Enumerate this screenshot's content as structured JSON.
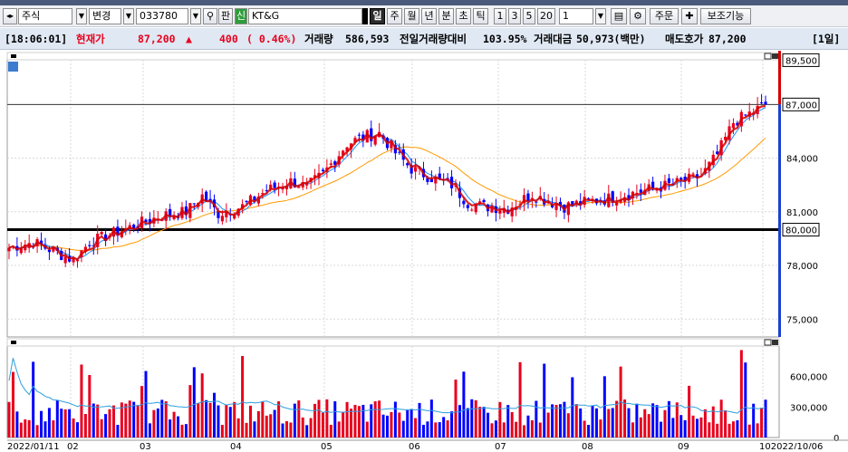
{
  "toolbar": {
    "market": "주식",
    "change_label": "변경",
    "code": "033780",
    "search_icon": "magnifier-icon",
    "pan_label": "판",
    "new_badge": "신",
    "stock_name": "KT&G",
    "periods": [
      "일",
      "주",
      "월",
      "년",
      "분",
      "초",
      "틱"
    ],
    "active_period": "일",
    "minute_options": [
      "1",
      "3",
      "5",
      "20"
    ],
    "count_value": "1",
    "order_label": "주문",
    "aux_label": "보조기능"
  },
  "info": {
    "time": "[18:06:01]",
    "price_label": "현재가",
    "price": "87,200",
    "change_sign": "▲",
    "change": "400",
    "change_pct": "( 0.46%)",
    "volume_label": "거래량",
    "volume": "586,593",
    "prev_vol_label": "전일거래량대비",
    "prev_vol_ratio": "103.95%",
    "amount_label": "거래대금",
    "amount": "50,973(백만)",
    "ask_label": "매도호가",
    "ask": "87,200",
    "period_badge": "[1일]"
  },
  "chart_data": {
    "type": "candlestick",
    "start_date": "2022/01/11",
    "end_date": "2022/10/06",
    "month_ticks": [
      "02",
      "03",
      "04",
      "05",
      "06",
      "07",
      "08",
      "09",
      "10"
    ],
    "price_axis_ticks": [
      "84,000",
      "81,000",
      "78,000",
      "75,000"
    ],
    "price_range": [
      74000,
      89500
    ],
    "markers": {
      "high": "89,500",
      "current": "87,000",
      "support": "80,000"
    },
    "support_level": 80000,
    "current_level": 87000,
    "volume_axis_ticks": [
      "600,000",
      "300,000",
      "0"
    ],
    "volume_range": [
      0,
      900000
    ],
    "price_path": [
      [
        0,
        79000
      ],
      [
        6,
        79300
      ],
      [
        12,
        78700
      ],
      [
        16,
        78300
      ],
      [
        20,
        79300
      ],
      [
        26,
        79800
      ],
      [
        32,
        80300
      ],
      [
        38,
        80800
      ],
      [
        44,
        81000
      ],
      [
        48,
        81900
      ],
      [
        52,
        80900
      ],
      [
        58,
        81300
      ],
      [
        64,
        82200
      ],
      [
        70,
        82700
      ],
      [
        74,
        82400
      ],
      [
        78,
        83100
      ],
      [
        84,
        84800
      ],
      [
        88,
        85200
      ],
      [
        92,
        85400
      ],
      [
        96,
        84300
      ],
      [
        100,
        83400
      ],
      [
        106,
        82800
      ],
      [
        110,
        82500
      ],
      [
        114,
        81500
      ],
      [
        118,
        81300
      ],
      [
        124,
        81200
      ],
      [
        130,
        82000
      ],
      [
        134,
        81600
      ],
      [
        138,
        81300
      ],
      [
        142,
        81500
      ],
      [
        148,
        81700
      ],
      [
        154,
        82000
      ],
      [
        160,
        82300
      ],
      [
        166,
        82600
      ],
      [
        172,
        83000
      ],
      [
        176,
        84200
      ],
      [
        180,
        86000
      ],
      [
        184,
        86500
      ],
      [
        188,
        87000
      ]
    ],
    "ma_color_fast": "#1e90ff",
    "ma_color_slow": "#ff9900",
    "up_color": "#e8001c",
    "down_color": "#0000ff"
  }
}
